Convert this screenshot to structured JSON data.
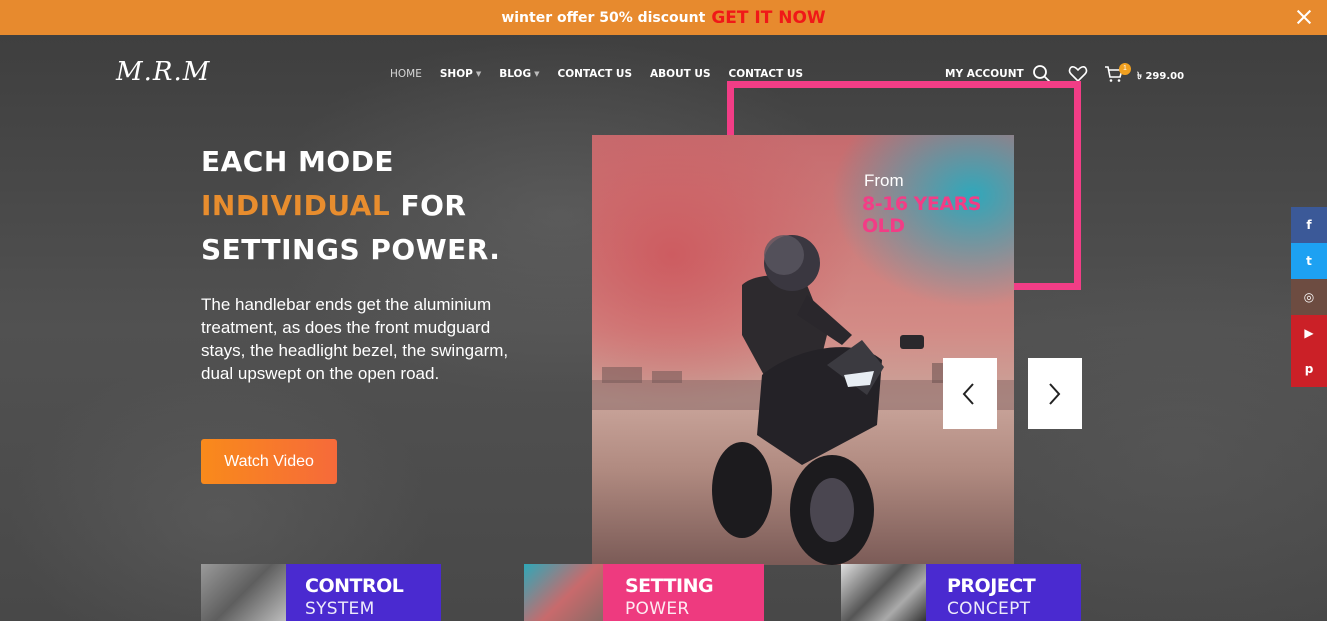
{
  "promo": {
    "text": "winter offer 50% discount",
    "cta": "GET IT NOW"
  },
  "header": {
    "logo": "M.R.M",
    "nav": [
      {
        "label": "HOME"
      },
      {
        "label": "SHOP"
      },
      {
        "label": "BLOG"
      },
      {
        "label": "CONTACT US"
      },
      {
        "label": "ABOUT US"
      },
      {
        "label": "CONTACT US"
      }
    ],
    "account": "MY ACCOUNT",
    "cart_count": "1",
    "cart_total": "৳ 299.00"
  },
  "hero": {
    "line1": "EACH MODE",
    "line2_highlight": "INDIVIDUAL",
    "line2_rest": " FOR",
    "line3": "SETTINGS POWER.",
    "description": "The handlebar ends get the aluminium treatment, as does the front mudguard stays, the headlight bezel, the swingarm, dual upswept on the open road.",
    "button": "Watch Video",
    "image_caption_small": "From",
    "image_caption_big": "8-16 YEARS OLD"
  },
  "social": [
    {
      "icon": "facebook-icon",
      "glyph": "f",
      "color": "#3b5998"
    },
    {
      "icon": "twitter-icon",
      "glyph": "t",
      "color": "#1da1f2"
    },
    {
      "icon": "instagram-icon",
      "glyph": "◎",
      "color": "#6d4c41"
    },
    {
      "icon": "youtube-icon",
      "glyph": "▶",
      "color": "#cb2027"
    },
    {
      "icon": "pinterest-icon",
      "glyph": "p",
      "color": "#cb2027"
    }
  ],
  "cards": [
    {
      "title": "CONTROL",
      "subtitle": "SYSTEM",
      "color": "#4a2ad0"
    },
    {
      "title": "SETTING",
      "subtitle": "POWER",
      "color": "#ee3a7f"
    },
    {
      "title": "PROJECT",
      "subtitle": "CONCEPT",
      "color": "#4a2ad0"
    }
  ]
}
